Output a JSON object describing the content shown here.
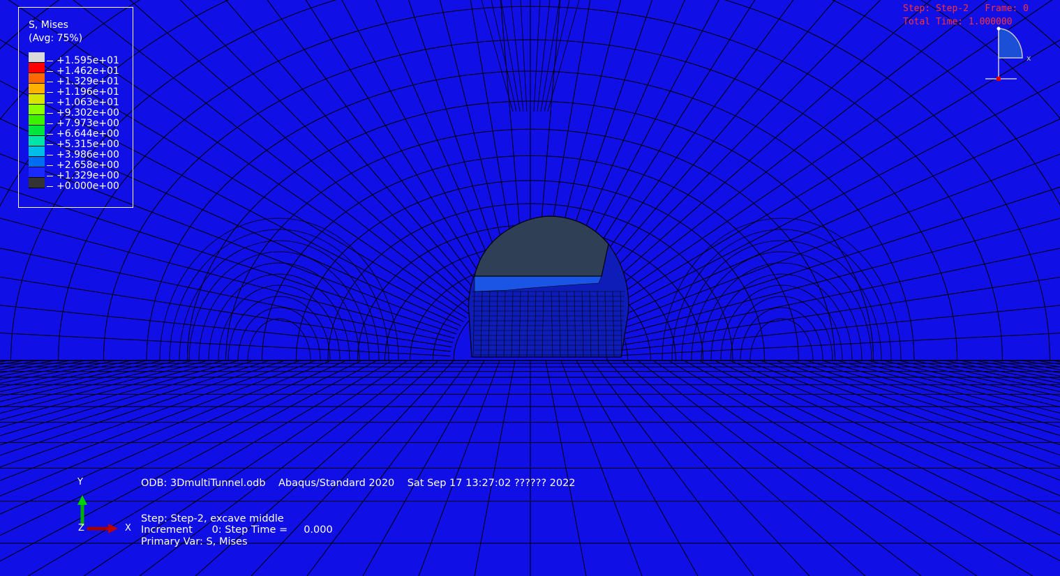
{
  "legend": {
    "title": "S, Mises",
    "subtitle": "(Avg: 75%)",
    "colors": [
      "#d9d9d9",
      "#ff0000",
      "#ff6a00",
      "#ffb300",
      "#d6e600",
      "#8cff00",
      "#3df200",
      "#00e63d",
      "#00e6a6",
      "#00bfe6",
      "#006ef0",
      "#1a2aff",
      "#333333"
    ],
    "values": [
      "+1.595e+01",
      "+1.462e+01",
      "+1.329e+01",
      "+1.196e+01",
      "+1.063e+01",
      "+9.302e+00",
      "+7.973e+00",
      "+6.644e+00",
      "+5.315e+00",
      "+3.986e+00",
      "+2.658e+00",
      "+1.329e+00",
      "+0.000e+00"
    ]
  },
  "step_info": {
    "line1": "Step: Step-2   Frame: 0",
    "line2": "Total Time: 1.000000"
  },
  "view_triad": {
    "x_label": "x"
  },
  "axis_triad": {
    "y_label": "Y",
    "x_label": "X",
    "z_label": "Z"
  },
  "info": {
    "odb": "ODB: 3DmultiTunnel.odb    Abaqus/Standard 2020    Sat Sep 17 13:27:02 ?????? 2022",
    "step": "Step: Step-2, excave middle",
    "increment": "Increment      0: Step Time =     0.000",
    "primary_var": "Primary Var: S, Mises"
  },
  "colors": {
    "background": "#1010e6",
    "mesh_line": "#000000",
    "tunnel_face": "#2f3f55",
    "tunnel_band": "#1a55e6"
  }
}
